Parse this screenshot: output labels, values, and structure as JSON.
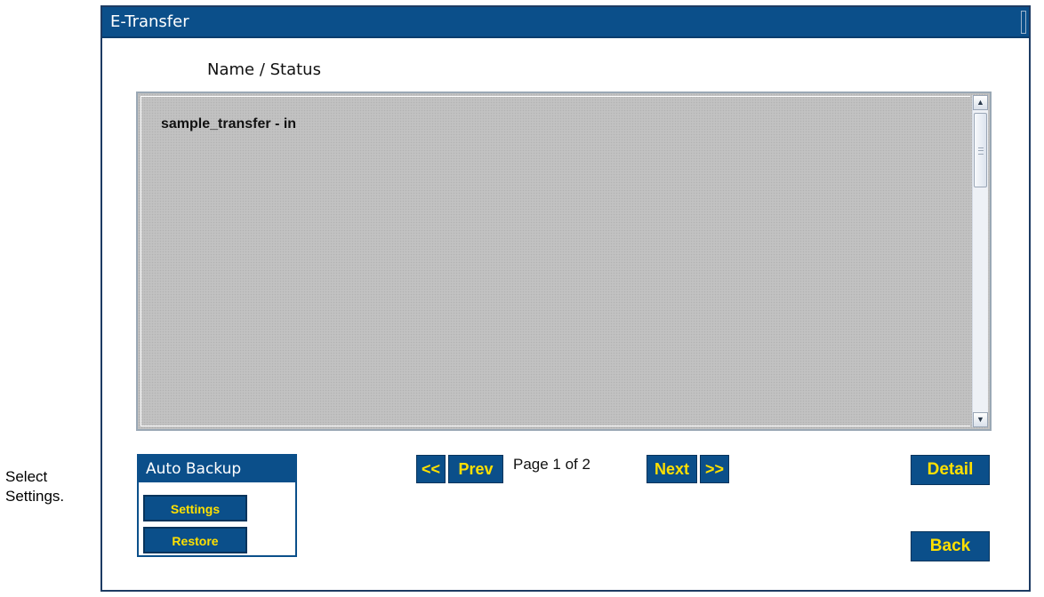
{
  "window": {
    "title": "E-Transfer"
  },
  "list": {
    "heading": "Name / Status",
    "items": [
      "sample_transfer - in"
    ]
  },
  "pagination": {
    "first_label": "<<",
    "prev_label": "Prev",
    "page_info": "Page 1 of 2",
    "next_label": "Next",
    "last_label": ">>"
  },
  "auto_backup": {
    "title": "Auto Backup",
    "settings_label": "Settings",
    "restore_label": "Restore"
  },
  "actions": {
    "detail_label": "Detail",
    "back_label": "Back"
  },
  "annotation": {
    "line1": "Select",
    "line2": "Settings."
  },
  "colors": {
    "accent": "#0b4f8a",
    "button_text": "#ffe000",
    "list_background": "#c2c2c2"
  },
  "icons": [
    "scroll-up-icon",
    "scroll-down-icon",
    "callout-arrow-icon"
  ]
}
